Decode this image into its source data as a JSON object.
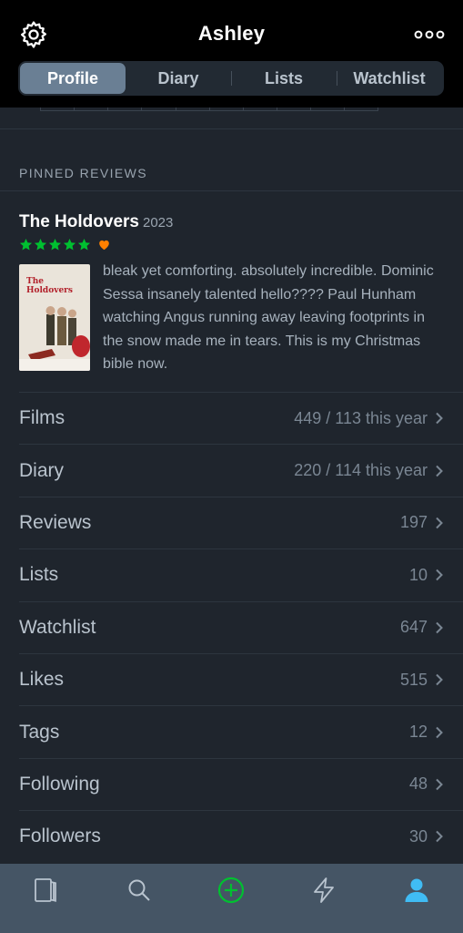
{
  "header": {
    "title": "Ashley",
    "settings_icon": "gear-icon",
    "more_icon": "more-dots-icon"
  },
  "segments": [
    {
      "label": "Profile",
      "active": true
    },
    {
      "label": "Diary",
      "active": false
    },
    {
      "label": "Lists",
      "active": false
    },
    {
      "label": "Watchlist",
      "active": false
    }
  ],
  "pinned": {
    "section_label": "PINNED REVIEWS",
    "film_title": "The Holdovers",
    "film_year": "2023",
    "poster_text": "The Holdovers",
    "rating_stars": 5,
    "rating_max": 5,
    "liked": true,
    "review_text": "bleak yet comforting. absolutely incredible. Dominic Sessa insanely talented hello???? Paul Hunham watching Angus running away leaving footprints in the snow made me in tears. This is my Christmas bible now."
  },
  "stats": [
    {
      "label": "Films",
      "value": "449 / 113 this year"
    },
    {
      "label": "Diary",
      "value": "220 / 114 this year"
    },
    {
      "label": "Reviews",
      "value": "197"
    },
    {
      "label": "Lists",
      "value": "10"
    },
    {
      "label": "Watchlist",
      "value": "647"
    },
    {
      "label": "Likes",
      "value": "515"
    },
    {
      "label": "Tags",
      "value": "12"
    },
    {
      "label": "Following",
      "value": "48"
    },
    {
      "label": "Followers",
      "value": "30"
    }
  ],
  "tabbar": [
    {
      "icon": "films-icon",
      "active": false
    },
    {
      "icon": "search-icon",
      "active": false
    },
    {
      "icon": "add-icon",
      "active": false
    },
    {
      "icon": "activity-icon",
      "active": false
    },
    {
      "icon": "profile-icon",
      "active": true
    }
  ],
  "colors": {
    "background": "#1f252d",
    "header": "#000000",
    "segment_active": "#6a7f94",
    "star_green": "#00c030",
    "heart_orange": "#ff8000",
    "add_green": "#00c030",
    "profile_blue": "#40bcf4",
    "tabbar": "#455565"
  }
}
